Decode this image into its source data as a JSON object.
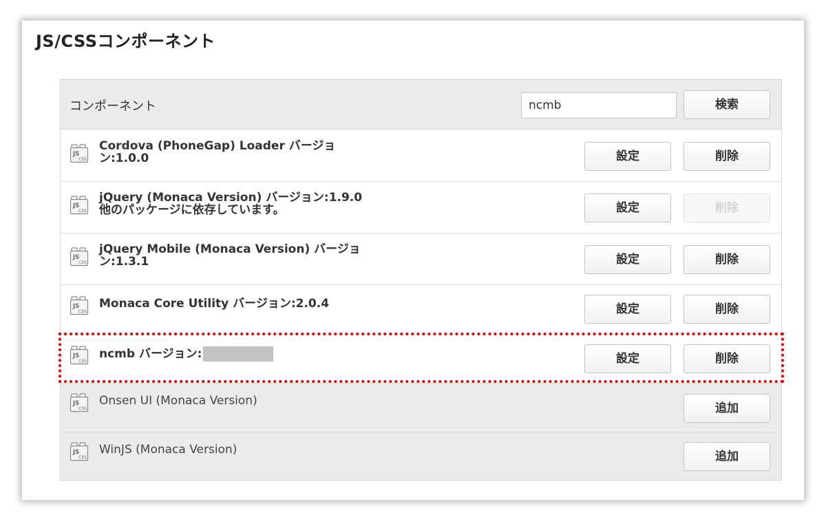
{
  "page": {
    "title": "JS/CSSコンポーネント"
  },
  "header": {
    "label": "コンポーネント",
    "search_value": "ncmb",
    "search_button": "検索"
  },
  "labels": {
    "settings": "設定",
    "delete": "削除",
    "add": "追加"
  },
  "icon": {
    "name": "js-css-component-icon",
    "text_top": "JS",
    "text_bottom": "CSS"
  },
  "components": [
    {
      "line1": "Cordova (PhoneGap) Loader バージョ",
      "line2": "ン:1.0.0",
      "status": "installed"
    },
    {
      "line1": "jQuery (Monaca Version) バージョン:1.9.0",
      "line2": "他のパッケージに依存しています。",
      "status": "installed",
      "delete_disabled": true
    },
    {
      "line1": "jQuery Mobile (Monaca Version) バージョ",
      "line2": "ン:1.3.1",
      "status": "installed"
    },
    {
      "line1": "Monaca Core Utility バージョン:2.0.4",
      "status": "installed"
    },
    {
      "line1": "ncmb バージョン:",
      "status": "installed",
      "version_redacted": true,
      "highlighted": true
    },
    {
      "line1": "Onsen UI (Monaca Version)",
      "status": "available"
    },
    {
      "line1": "WinJS (Monaca Version)",
      "status": "available"
    }
  ],
  "colors": {
    "highlight_border": "#e00000",
    "header_bg": "#ebebeb",
    "redaction": "#c2c2c2"
  }
}
